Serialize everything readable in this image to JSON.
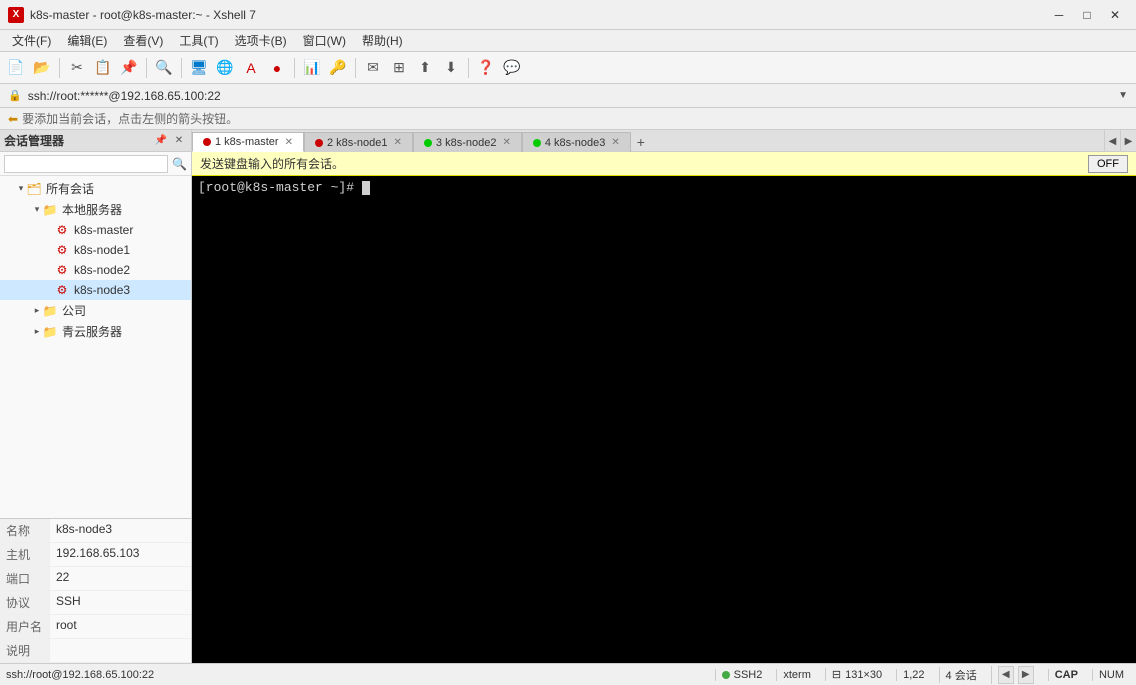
{
  "titlebar": {
    "icon_text": "X",
    "title": "k8s-master - root@k8s-master:~ - Xshell 7",
    "min_btn": "─",
    "max_btn": "□",
    "close_btn": "✕"
  },
  "menubar": {
    "items": [
      "文件(F)",
      "编辑(E)",
      "查看(V)",
      "工具(T)",
      "选项卡(B)",
      "窗口(W)",
      "帮助(H)"
    ]
  },
  "address_bar": {
    "text": "ssh://root:******@192.168.65.100:22",
    "lock_icon": "🔒"
  },
  "session_banner": {
    "text": "要添加当前会话，点击左侧的箭头按钮。",
    "icon": "⬅"
  },
  "sidebar": {
    "title": "会话管理器",
    "tree": [
      {
        "id": "all-sessions",
        "label": "所有会话",
        "indent": 1,
        "type": "folder",
        "expanded": true
      },
      {
        "id": "local-server",
        "label": "本地服务器",
        "indent": 2,
        "type": "folder",
        "expanded": true
      },
      {
        "id": "k8s-master",
        "label": "k8s-master",
        "indent": 3,
        "type": "server"
      },
      {
        "id": "k8s-node1",
        "label": "k8s-node1",
        "indent": 3,
        "type": "server"
      },
      {
        "id": "k8s-node2",
        "label": "k8s-node2",
        "indent": 3,
        "type": "server"
      },
      {
        "id": "k8s-node3",
        "label": "k8s-node3",
        "indent": 3,
        "type": "server"
      },
      {
        "id": "company",
        "label": "公司",
        "indent": 2,
        "type": "folder",
        "expanded": false
      },
      {
        "id": "qingyun",
        "label": "青云服务器",
        "indent": 2,
        "type": "folder",
        "expanded": false
      }
    ],
    "info": {
      "rows": [
        {
          "label": "名称",
          "value": "k8s-node3"
        },
        {
          "label": "主机",
          "value": "192.168.65.103"
        },
        {
          "label": "端口",
          "value": "22"
        },
        {
          "label": "协议",
          "value": "SSH"
        },
        {
          "label": "用户名",
          "value": "root"
        },
        {
          "label": "说明",
          "value": ""
        }
      ]
    }
  },
  "tabs": [
    {
      "id": "tab1",
      "label": "1 k8s-master",
      "active": true,
      "dot": "red"
    },
    {
      "id": "tab2",
      "label": "2 k8s-node1",
      "active": false,
      "dot": "red"
    },
    {
      "id": "tab3",
      "label": "3 k8s-node2",
      "active": false,
      "dot": "green"
    },
    {
      "id": "tab4",
      "label": "4 k8s-node3",
      "active": false,
      "dot": "green"
    }
  ],
  "send_all_bar": {
    "text": "发送键盘输入的所有会话。",
    "off_label": "OFF"
  },
  "terminal": {
    "prompt": "[root@k8s-master ~]# "
  },
  "statusbar": {
    "ssh_text": "ssh://root@192.168.65.100:22",
    "protocol": "SSH2",
    "terminal_type": "xterm",
    "size": "131×30",
    "cursor_pos": "1,22",
    "sessions": "4 会话",
    "cap": "CAP",
    "num": "NUM"
  }
}
